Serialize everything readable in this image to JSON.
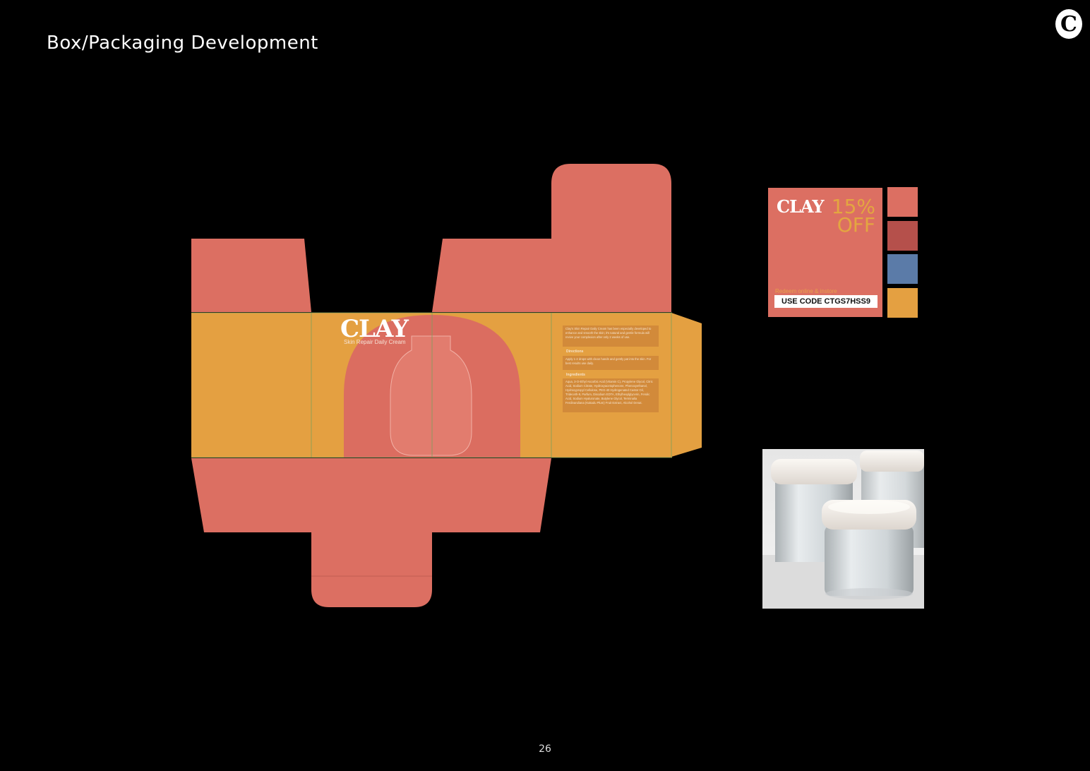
{
  "header": {
    "title": "Box/Packaging Development",
    "logo_letter": "C"
  },
  "box": {
    "brand": "CLAY",
    "product_name": "Skin Repair Daily Cream",
    "description": "Clay's Skin Repair Daily Cream has been especially developed to enhance and smooth the skin; it's natural and gentle formula will revive your complexion after only 2 weeks of use.",
    "directions_heading": "Directions",
    "directions": "Apply 1-2 drops with clean hands and gently pat into the skin. For best results use daily.",
    "ingredients_heading": "Ingredients",
    "ingredients": "Aqua, 3-O-Ethyl Ascorbic Acid (Vitamin C), Propylene Glycol, Citric Acid, Sodium Citrate, Hydroxyacetophenone, Phenoxyethanol, Hydroxypropyl Cellulose, PEG-40 Hydrogenated Castor Oil, Trideceth-9, Parfum, Disodium EDTA, Ethylhexylglycerin, Ferulic Acid, Sodium Hyaluronate, Butylene Glycol, Terminalia Ferdinandiana (Kakadu Plum) Fruit Extract, Alcohol Denat."
  },
  "promo": {
    "brand": "CLAY",
    "offer": "15% OFF",
    "note": "Redeem online & instore",
    "code": "USE CODE CTGS7HSS9"
  },
  "palette": {
    "coral": "#dc6f62",
    "red": "#b5504b",
    "blue": "#5b7ba8",
    "orange": "#e4a041"
  },
  "page": {
    "number": "26"
  }
}
